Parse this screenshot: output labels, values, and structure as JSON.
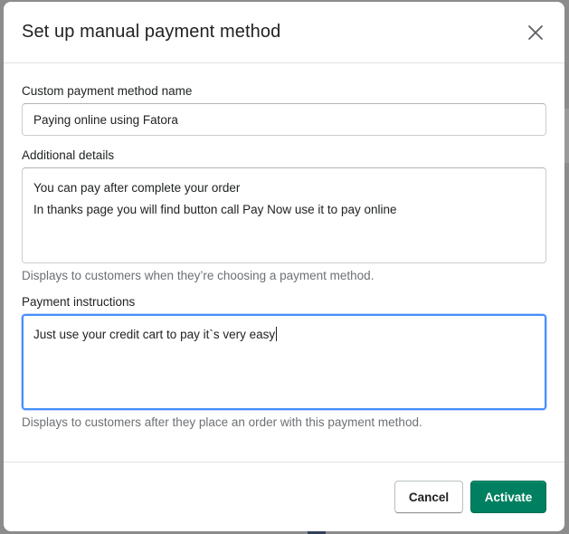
{
  "modal": {
    "title": "Set up manual payment method",
    "close_icon": "close-icon"
  },
  "fields": {
    "name": {
      "label": "Custom payment method name",
      "value": "Paying online using Fatora"
    },
    "details": {
      "label": "Additional details",
      "lines": [
        "You can pay after complete your order",
        "In thanks page you will find button call Pay Now use it to pay online"
      ],
      "help": "Displays to customers when they’re choosing a payment method."
    },
    "instructions": {
      "label": "Payment instructions",
      "value": "Just use your credit cart to pay it`s very easy",
      "help": "Displays to customers after they place an order with this payment method."
    }
  },
  "footer": {
    "cancel_label": "Cancel",
    "activate_label": "Activate"
  },
  "colors": {
    "primary": "#008060",
    "focus_ring": "#458fff",
    "overlay": "#8c8c8c"
  }
}
